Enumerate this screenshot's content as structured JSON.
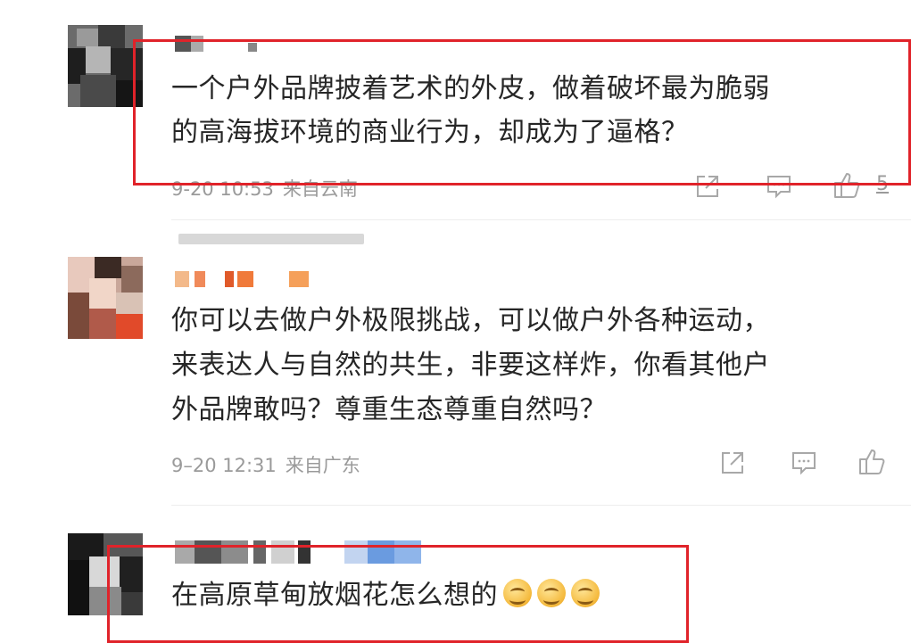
{
  "comments": [
    {
      "text_line1": "一个户外品牌披着艺术的外皮，做着破坏最为脆弱",
      "text_line2": "的高海拔环境的商业行为，却成为了逼格？",
      "time": "9-20 10:53",
      "source": "来自云南",
      "like_count": "5"
    },
    {
      "text_line1": "你可以去做户外极限挑战，可以做户外各种运动，",
      "text_line2": "来表达人与自然的共生，非要这样炸，你看其他户",
      "text_line3": "外品牌敢吗？尊重生态尊重自然吗？",
      "time": "9–20 12:31",
      "source": "来自广东"
    },
    {
      "text": "在高原草甸放烟花怎么想的"
    }
  ],
  "icons": {
    "share": "share-icon",
    "comment": "comment-icon",
    "like": "thumbs-up-icon",
    "emoji": "grin-emoji-icon"
  },
  "colors": {
    "highlight_box": "#e0232a",
    "meta_text": "#9a9a9a",
    "body_text": "#262626"
  }
}
